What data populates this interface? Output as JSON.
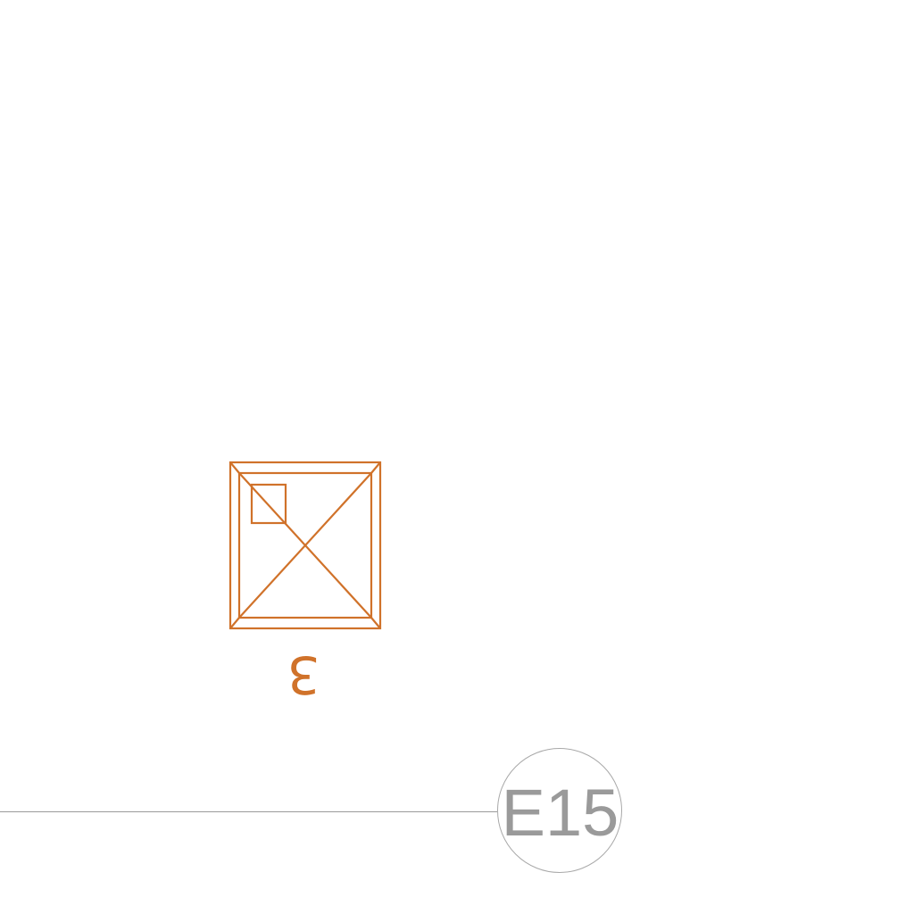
{
  "symbol": {
    "mark_label": "3",
    "color": "#d0722a",
    "icon": "window-symbol-icon"
  },
  "grid": {
    "bubble_label": "E15",
    "color": "#9a9a9a"
  }
}
